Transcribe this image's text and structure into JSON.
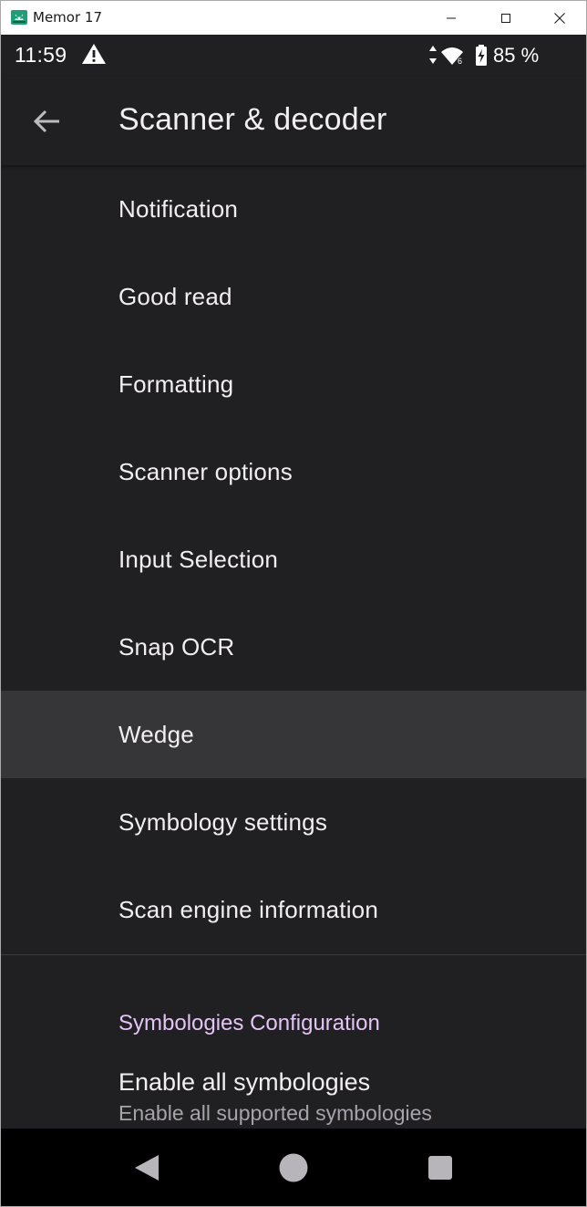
{
  "window": {
    "title": "Memor 17"
  },
  "statusbar": {
    "time": "11:59",
    "battery": "85 %",
    "icons": [
      "warning-icon",
      "data-arrows-icon",
      "wifi-icon",
      "battery-charging-icon"
    ],
    "network_badge": "6"
  },
  "appbar": {
    "title": "Scanner & decoder",
    "back_icon": "arrow-left-icon"
  },
  "menu": {
    "items": [
      {
        "label": "Notification"
      },
      {
        "label": "Good read"
      },
      {
        "label": "Formatting"
      },
      {
        "label": "Scanner options"
      },
      {
        "label": "Input Selection"
      },
      {
        "label": "Snap OCR"
      },
      {
        "label": "Wedge",
        "selected": true
      },
      {
        "label": "Symbology settings"
      },
      {
        "label": "Scan engine information"
      }
    ]
  },
  "symbologies": {
    "category": "Symbologies Configuration",
    "enable_all": {
      "title": "Enable all symbologies",
      "summary": "Enable all supported symbologies"
    }
  },
  "navbar": {
    "buttons": [
      "back-triangle-icon",
      "home-circle-icon",
      "recents-square-icon"
    ]
  },
  "colors": {
    "background": "#201f22",
    "selected_row": "#363538",
    "text_primary": "#f1eff3",
    "category_accent": "#e4c4f6",
    "text_secondary": "#a6a3aa",
    "navbar": "#000000"
  }
}
